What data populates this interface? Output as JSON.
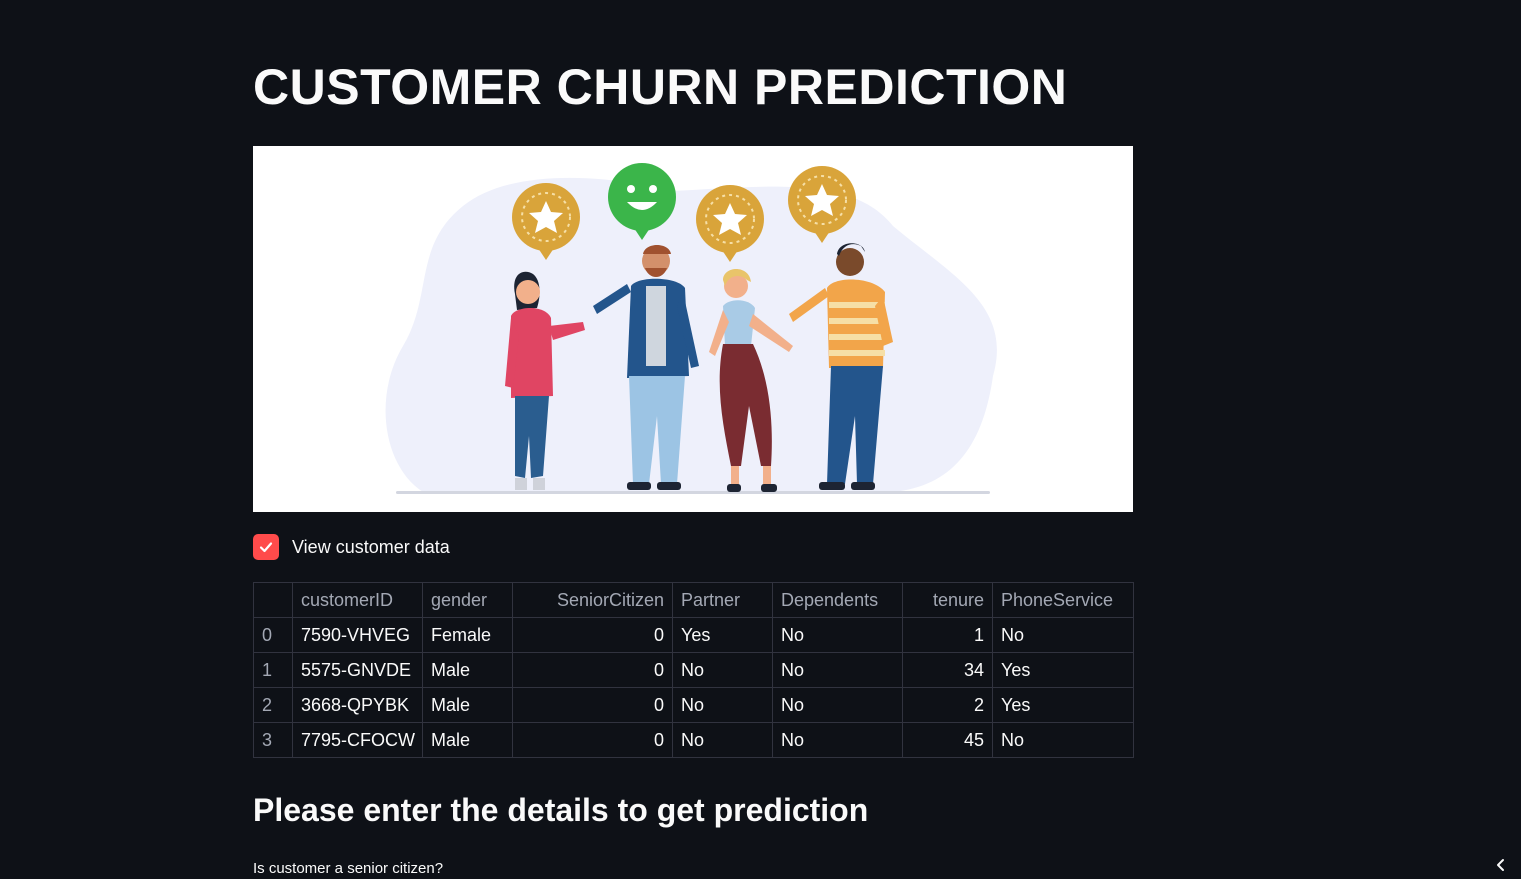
{
  "page": {
    "title": "CUSTOMER CHURN PREDICTION"
  },
  "hero_image": {
    "description_icons": [
      "star-badge-icon",
      "smiley-face-icon",
      "star-badge-icon",
      "star-badge-icon"
    ]
  },
  "view_data_checkbox": {
    "label": "View customer data",
    "checked": true
  },
  "customer_table": {
    "columns": [
      "",
      "customerID",
      "gender",
      "SeniorCitizen",
      "Partner",
      "Dependents",
      "tenure",
      "PhoneService"
    ],
    "rows": [
      [
        "0",
        "7590-VHVEG",
        "Female",
        "0",
        "Yes",
        "No",
        "1",
        "No"
      ],
      [
        "1",
        "5575-GNVDE",
        "Male",
        "0",
        "No",
        "No",
        "34",
        "Yes"
      ],
      [
        "2",
        "3668-QPYBK",
        "Male",
        "0",
        "No",
        "No",
        "2",
        "Yes"
      ],
      [
        "3",
        "7795-CFOCW",
        "Male",
        "0",
        "No",
        "No",
        "45",
        "No"
      ]
    ]
  },
  "form": {
    "heading": "Please enter the details to get prediction",
    "senior_citizen_label": "Is customer a senior citizen?"
  },
  "colors": {
    "background": "#0e1117",
    "accent": "#ff4b4b",
    "text": "#fafafa",
    "muted": "#a3a8b4",
    "border": "#31333f"
  }
}
